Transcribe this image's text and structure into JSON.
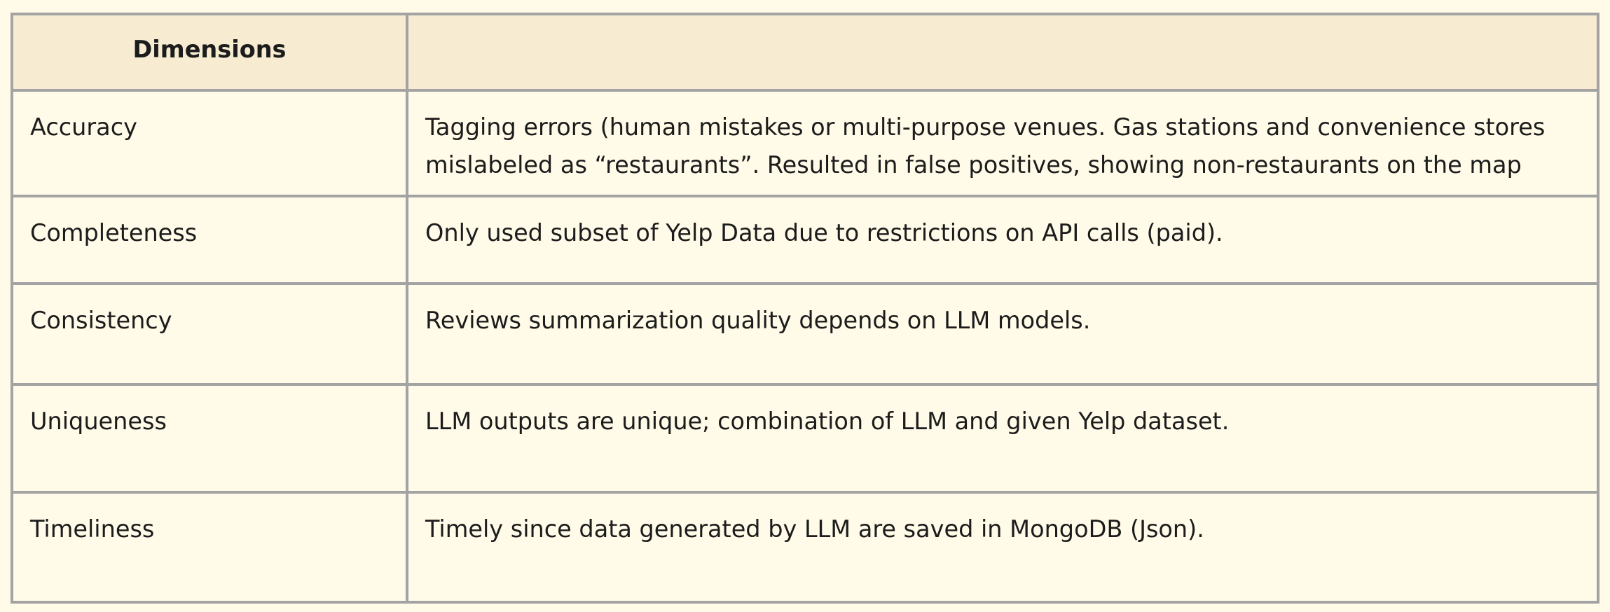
{
  "table": {
    "headers": [
      "Dimensions",
      ""
    ],
    "rows": [
      {
        "dimension": "Accuracy",
        "description": "Tagging errors (human mistakes or multi-purpose venues. Gas stations and convenience stores mislabeled as “restaurants”. Resulted in false positives, showing non-restaurants on the map"
      },
      {
        "dimension": "Completeness",
        "description": "Only used subset of Yelp Data due to restrictions on API calls (paid)."
      },
      {
        "dimension": "Consistency",
        "description": "Reviews summarization quality depends on LLM models."
      },
      {
        "dimension": "Uniqueness",
        "description": "LLM outputs are unique; combination of LLM and given Yelp dataset."
      },
      {
        "dimension": "Timeliness",
        "description": "Timely since data generated by LLM are saved in MongoDB (Json)."
      }
    ]
  }
}
